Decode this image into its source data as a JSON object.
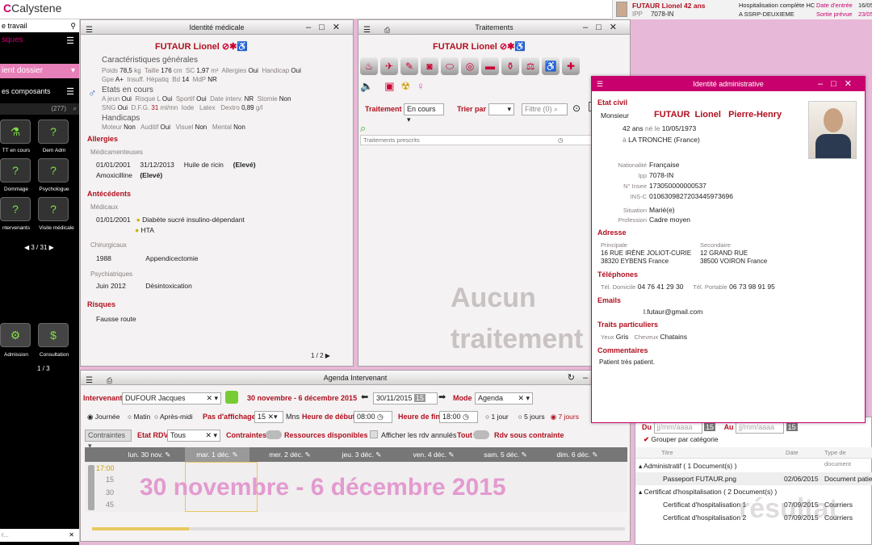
{
  "app": {
    "name": "Calystene"
  },
  "patient_header": {
    "name": "FUTAUR Lionel 42 ans",
    "ipp_label": "IPP",
    "ipp": "7078-IN",
    "hosp": "Hospitalisation complète HC",
    "service": "A SSRP-DEUXIEME",
    "entry_label": "Date d'entrée",
    "entry_date": "16/05",
    "exit_label": "Sortie prévue",
    "exit_value": "23/05"
  },
  "sidebar": {
    "plan_label": "e travail",
    "risques_label": "sques",
    "dossier_label": "ient dossier",
    "composants_label": "es composants",
    "count": "(277)",
    "tiles": [
      "TT en cours",
      "Dem Adm",
      "Dommage",
      "Psychologue",
      "ntervenants",
      "Visite médicale"
    ],
    "pager": "3 / 31",
    "tiles2": [
      "Admission",
      "Consultation"
    ],
    "pager2": "1 / 3",
    "search_placeholder": "r..."
  },
  "identite_medicale": {
    "title": "Identité médicale",
    "patient": "FUTAUR Lionel",
    "caracteristiques": "Caractéristiques générales",
    "poids_l": "Poids",
    "poids": "78,5",
    "poids_u": "kg",
    "taille_l": "Taille",
    "taille": "176",
    "taille_u": "cm",
    "sc_l": "SC",
    "sc": "1,97",
    "sc_u": "m²",
    "allergies_l": "Allergies",
    "allergies": "Oui",
    "handicap_l": "Handicap",
    "handicap": "Oui",
    "gpe_l": "Gpe",
    "gpe": "A+",
    "insuff_l": "Insuff. Hépatiq",
    "bd_l": "Bd",
    "bd": "14",
    "mdp_l": "MdP",
    "mdp": "NR",
    "etats": "Etats en cours",
    "ajeun_l": "A jeun",
    "ajeun": "Oui",
    "risque_l": "Risque L",
    "risque": "Oui",
    "sportif_l": "Sportif",
    "sportif": "Oui",
    "interv_l": "Date interv.",
    "interv": "NR",
    "stomie_l": "Stomie",
    "stomie": "Non",
    "sng_l": "SNG",
    "sng": "Oui",
    "dfg_l": "D.F.G.",
    "dfg": "31",
    "dfg_u": "ml/mn",
    "iode_l": "Iode",
    "latex_l": "Latex",
    "dextro_l": "Dextro",
    "dextro": "0,89",
    "dextro_u": "g/l",
    "handicaps": "Handicaps",
    "moteur_l": "Moteur",
    "moteur": "Non",
    "auditif_l": "Auditif",
    "auditif": "Oui",
    "visuel_l": "Visuel",
    "visuel": "Non",
    "mental_l": "Mental",
    "mental": "Non",
    "allergies_sect": "Allergies",
    "medicamenteuses": "Médicamenteuses",
    "a1_d1": "01/01/2001",
    "a1_d2": "31/12/2013",
    "a1_n": "Huile de ricin",
    "a1_l": "(Elevé)",
    "a2_n": "Amoxicilline",
    "a2_l": "(Elevé)",
    "antecedents": "Antécédents",
    "medicaux": "Médicaux",
    "m1_d": "01/01/2001",
    "m1_n": "Diabète sucré insulino-dépendant",
    "m2_n": "HTA",
    "chirurgicaux": "Chirurgicaux",
    "c1_d": "1988",
    "c1_n": "Appendicectomie",
    "psychiatriques": "Psychiatriques",
    "p1_d": "Juin 2012",
    "p1_n": "Désintoxication",
    "risques": "Risques",
    "r1": "Fausse route",
    "pager": "1 / 2"
  },
  "traitements": {
    "title": "Traitements",
    "patient": "FUTAUR Lionel",
    "traitement_l": "Traitement",
    "traitement_v": "En cours",
    "trier_l": "Trier par",
    "filtre": "Filtre (0)",
    "prescrits": "Traitements prescrits",
    "empty1": "Aucun",
    "empty2": "traitement"
  },
  "admin": {
    "title": "Identité administrative",
    "etat_civil": "Etat civil",
    "civ": "Monsieur",
    "nom": "FUTAUR",
    "prenom": "Lionel",
    "prenom2": "Pierre-Henry",
    "age": "42 ans",
    "ne_le": "né le",
    "dob": "10/05/1973",
    "a": "à",
    "ville": "LA TRONCHE",
    "pays": "(France)",
    "nat_l": "Nationalité",
    "nat": "Française",
    "ipp_l": "Ipp",
    "ipp": "7078-IN",
    "insee_l": "N° Insee",
    "insee": "173050000000537",
    "insc_l": "INS-C",
    "insc": "0106309827203445973696",
    "sit_l": "Situation",
    "sit": "Marié(e)",
    "prof_l": "Profession",
    "prof": "Cadre moyen",
    "adresse": "Adresse",
    "principale": "Principale",
    "p1": "16 RUE IRÈNE JOLIOT-CURIE",
    "p2": "38320 EYBENS France",
    "secondaire": "Secondaire",
    "s1": "12 GRAND RUE",
    "s2": "38500 VOIRON France",
    "telephones": "Téléphones",
    "tdom_l": "Tél. Domicile",
    "tdom": "04 76 41 29 30",
    "tport_l": "Tél. Portable",
    "tport": "06 73 98 91 95",
    "emails": "Emails",
    "email": "l.futaur@gmail.com",
    "traits": "Traits particuliers",
    "yeux_l": "Yeux",
    "yeux": "Gris",
    "chev_l": "Cheveux",
    "chev": "Chatains",
    "comm": "Commentaires",
    "comm_v": "Patient très patient."
  },
  "agenda": {
    "title": "Agenda Intervenant",
    "interv_l": "Intervenant",
    "interv": "DUFOUR Jacques",
    "range": "30 novembre - 6 décembre 2015",
    "date": "30/11/2015",
    "cal": "15",
    "mode_l": "Mode",
    "mode": "Agenda",
    "journee": "Journée",
    "matin": "Matin",
    "apres": "Après-midi",
    "pas_l": "Pas d'affichage",
    "pas": "15",
    "mns": "Mns",
    "hdeb_l": "Heure de début",
    "hdeb": "08:00",
    "hfin_l": "Heure de fin",
    "hfin": "18:00",
    "j1": "1 jour",
    "j5": "5 jours",
    "j7": "7 jours",
    "contraintes_sel": "Contraintes",
    "etat_l": "Etat RDV",
    "etat": "Tous",
    "contraintes_tog": "Contraintes",
    "ressources": "Ressources disponibles",
    "annules": "Afficher les rdv annulés",
    "tout": "Tout",
    "sous": "Rdv sous contrainte",
    "days": [
      "lun. 30 nov.",
      "mar. 1 déc.",
      "mer. 2 déc.",
      "jeu. 3 déc.",
      "ven. 4 déc.",
      "sam. 5 déc.",
      "dim. 6 déc."
    ],
    "times": [
      "17:00",
      "15",
      "30",
      "45"
    ],
    "big": "30 novembre - 6 décembre 2015"
  },
  "documents": {
    "du": "Du",
    "au": "Au",
    "ph": "jj/mm/aaaa",
    "grouper": "Grouper par catégorie",
    "col_titre": "Titre",
    "col_date": "Date",
    "col_type": "Type de document",
    "g1": "Administratif  ( 1 Document(s) )",
    "d1": "Passeport FUTAUR.png",
    "d1_date": "02/06/2015",
    "d1_type": "Document patient",
    "g2": "Certificat d'hospitalisation  ( 2 Document(s) )",
    "d2": "Certificat d'hospitalisation 1",
    "d2_date": "07/09/2015",
    "d2_type": "Courriers",
    "d3": "Certificat d'hospitalisation 2",
    "d3_date": "07/09/2015",
    "d3_type": "Courriers",
    "bg": "résultat"
  }
}
